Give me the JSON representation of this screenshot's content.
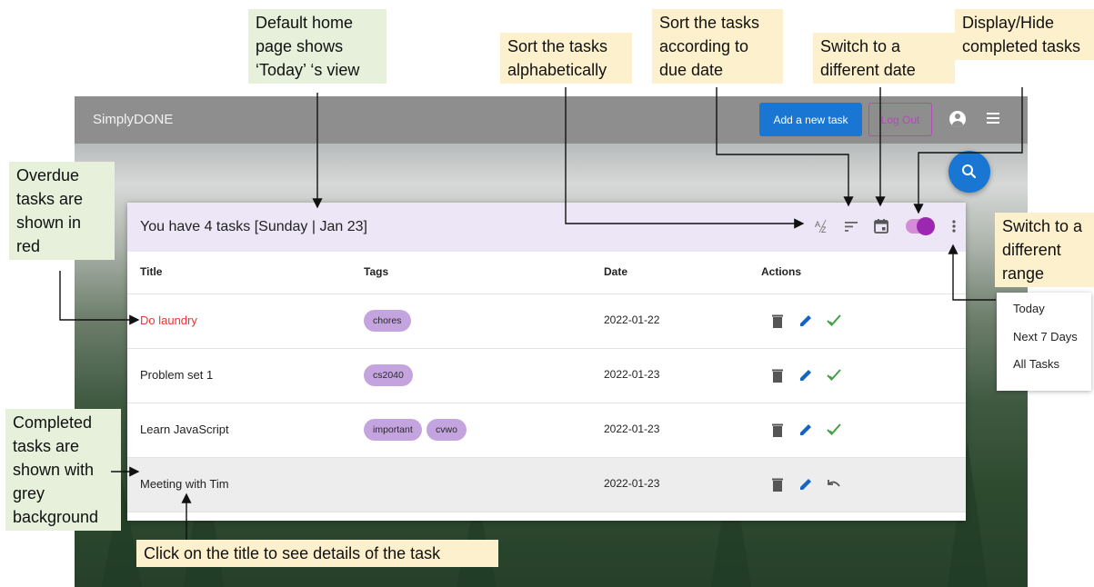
{
  "navbar": {
    "brand": "SimplyDONE",
    "add_task_label": "Add a new task",
    "logout_label": "Log Out",
    "account_icon": "account-circle-icon",
    "menu_icon": "menu-icon",
    "search_icon": "search-icon"
  },
  "card": {
    "title": "You have 4 tasks [Sunday | Jan 23]",
    "header_icons": [
      "sort-alpha-icon",
      "sort-date-icon",
      "calendar-icon",
      "completed-toggle",
      "more-vert-icon"
    ],
    "columns": [
      "Title",
      "Tags",
      "Date",
      "Actions"
    ],
    "rows": [
      {
        "title": "Do laundry",
        "tags": [
          "chores"
        ],
        "date": "2022-01-22",
        "status": "overdue"
      },
      {
        "title": "Problem set 1",
        "tags": [
          "cs2040"
        ],
        "date": "2022-01-23",
        "status": "pending"
      },
      {
        "title": "Learn JavaScript",
        "tags": [
          "important",
          "cvwo"
        ],
        "date": "2022-01-23",
        "status": "pending"
      },
      {
        "title": "Meeting with Tim",
        "tags": [],
        "date": "2022-01-23",
        "status": "completed"
      }
    ]
  },
  "range_menu": {
    "items": [
      "Today",
      "Next 7 Days",
      "All Tasks"
    ]
  },
  "annotations": {
    "default_view": "Default home page shows ‘Today’ ‘s view",
    "sort_alpha": "Sort the tasks alphabetically",
    "sort_date": "Sort the tasks according to due date",
    "switch_date": "Switch to a different date",
    "toggle_completed": "Display/Hide completed tasks",
    "overdue": "Overdue tasks are shown in red",
    "switch_range": "Switch to a different range",
    "completed": "Completed tasks are shown with grey background",
    "click_title": "Click on the title to see details of the task"
  },
  "colors": {
    "navbar": "#8e8e8e",
    "primary": "#1976d2",
    "accent": "#9c27b0",
    "card_header": "#ece6f6",
    "tag": "#c4a4de",
    "overdue": "#e53935",
    "done_check": "#43a047",
    "annotation_yellow": "#fdf0cc",
    "annotation_green": "#e6f0db"
  }
}
